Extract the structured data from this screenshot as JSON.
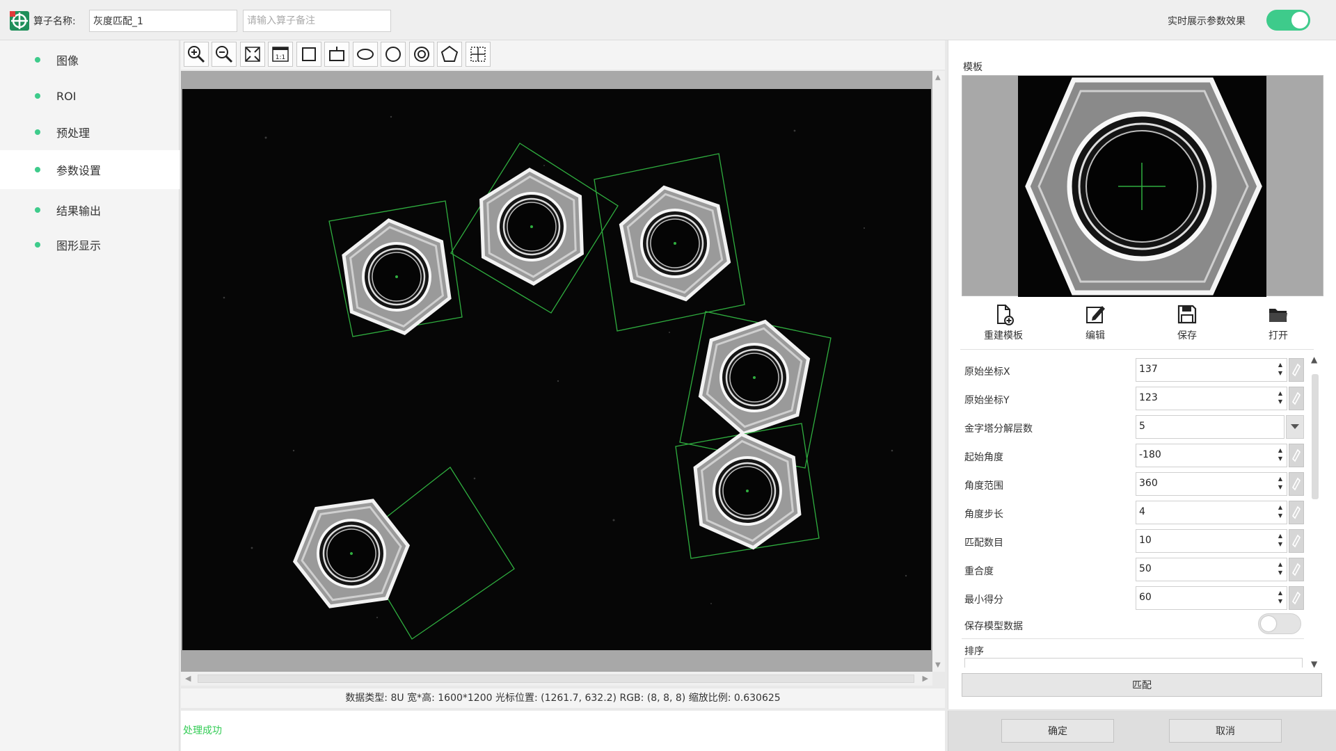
{
  "header": {
    "op_name_label": "算子名称:",
    "op_name_value": "灰度匹配_1",
    "op_remark_placeholder": "请输入算子备注",
    "realtime_label": "实时展示参数效果",
    "realtime_enabled": true
  },
  "sidebar": {
    "items": [
      {
        "label": "图像",
        "active": false
      },
      {
        "label": "ROI",
        "active": false
      },
      {
        "label": "预处理",
        "active": false
      },
      {
        "label": "参数设置",
        "active": true
      },
      {
        "label": "结果输出",
        "active": false
      },
      {
        "label": "图形显示",
        "active": false
      }
    ]
  },
  "toolbar": {
    "tools": [
      "zoom-in-icon",
      "zoom-out-icon",
      "fit-window-icon",
      "actual-size-icon",
      "rectangle-icon",
      "rotated-rectangle-icon",
      "ellipse-icon",
      "circle-icon",
      "ring-icon",
      "polygon-icon",
      "crosshair-icon"
    ]
  },
  "status": {
    "info": "数据类型: 8U 宽*高: 1600*1200 光标位置: (1261.7, 632.2) RGB: (8, 8, 8) 缩放比例: 0.630625",
    "message": "处理成功"
  },
  "template": {
    "label": "模板",
    "buttons": [
      {
        "label": "重建模板",
        "icon": "new-template-icon"
      },
      {
        "label": "编辑",
        "icon": "edit-icon"
      },
      {
        "label": "保存",
        "icon": "save-icon"
      },
      {
        "label": "打开",
        "icon": "open-folder-icon"
      }
    ]
  },
  "params": [
    {
      "label": "原始坐标X",
      "value": "137",
      "kind": "spin"
    },
    {
      "label": "原始坐标Y",
      "value": "123",
      "kind": "spin"
    },
    {
      "label": "金字塔分解层数",
      "value": "5",
      "kind": "select"
    },
    {
      "label": "起始角度",
      "value": "-180",
      "kind": "spin"
    },
    {
      "label": "角度范围",
      "value": "360",
      "kind": "spin"
    },
    {
      "label": "角度步长",
      "value": "4",
      "kind": "spin"
    },
    {
      "label": "匹配数目",
      "value": "10",
      "kind": "spin"
    },
    {
      "label": "重合度",
      "value": "50",
      "kind": "spin"
    },
    {
      "label": "最小得分",
      "value": "60",
      "kind": "spin"
    }
  ],
  "save_model": {
    "label": "保存模型数据",
    "enabled": false
  },
  "sort": {
    "label": "排序"
  },
  "actions": {
    "match": "匹配",
    "confirm": "确定",
    "cancel": "取消"
  },
  "colors": {
    "accent": "#3ecb8b",
    "match_box": "#2fae3f",
    "success_text": "#33cc55"
  }
}
